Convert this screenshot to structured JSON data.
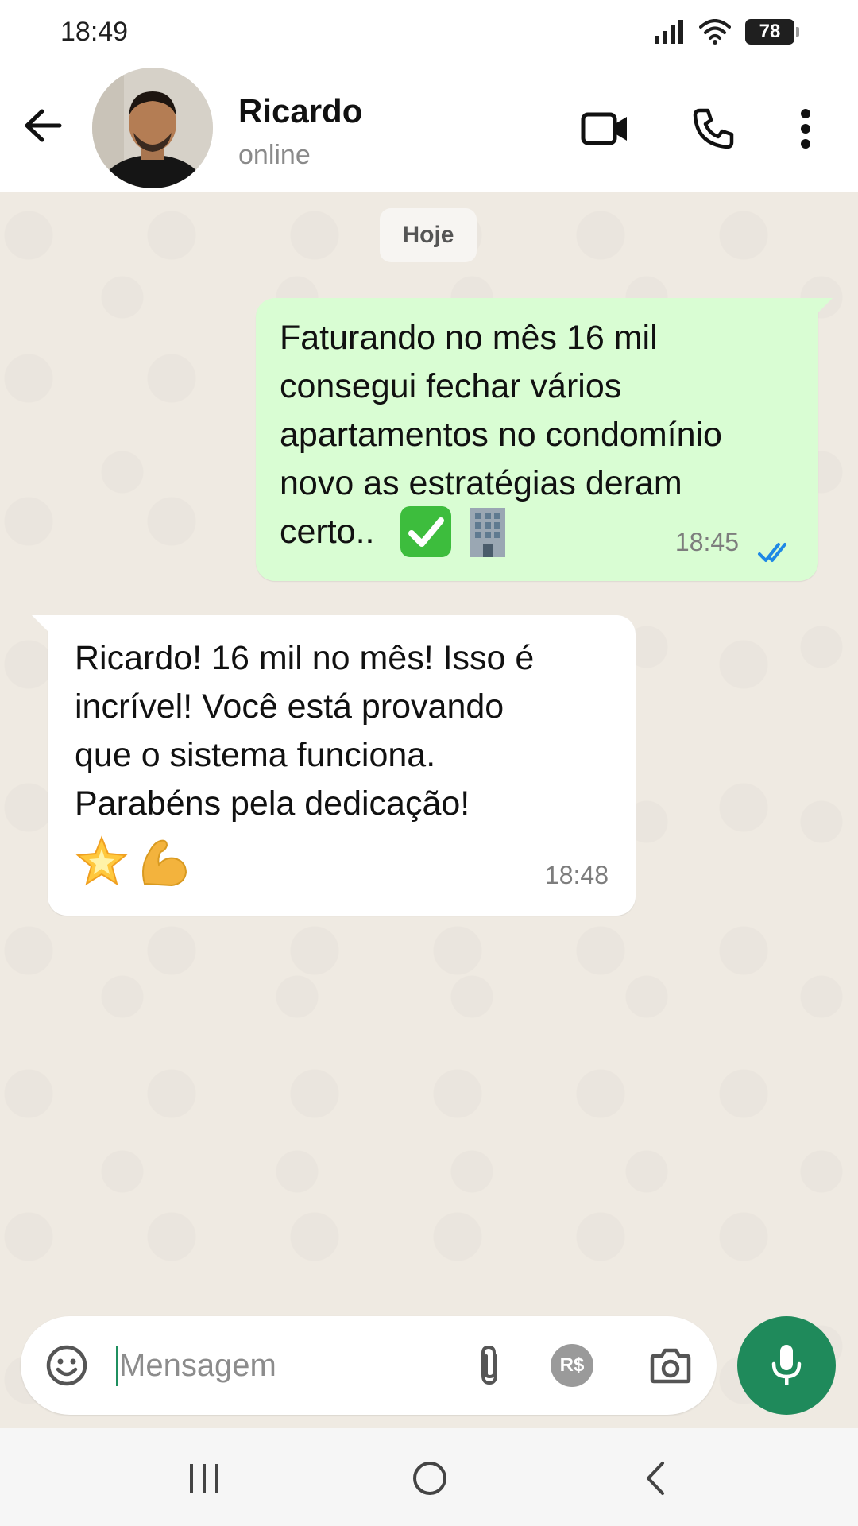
{
  "status_bar": {
    "time": "18:49",
    "battery": "78",
    "icons": [
      "signal-icon",
      "wifi-icon",
      "battery-icon"
    ]
  },
  "header": {
    "contact_name": "Ricardo",
    "contact_status": "online",
    "icons": [
      "back-arrow-icon",
      "video-call-icon",
      "phone-icon",
      "more-vert-icon"
    ]
  },
  "chat": {
    "date_chip": "Hoje",
    "messages": [
      {
        "direction": "outgoing",
        "text": "Faturando no mês 16 mil\nconsegui fechar vários\napartamentos no condomínio\nnovo as estratégias deram\ncerto..",
        "emojis": [
          "check-mark-emoji",
          "office-building-emoji"
        ],
        "time": "18:45",
        "read": true
      },
      {
        "direction": "incoming",
        "text": "Ricardo! 16 mil no mês! Isso é\nincrível! Você está provando\nque o sistema funciona.\nParabéns pela dedicação!",
        "emojis": [
          "glowing-star-emoji",
          "flexed-biceps-emoji"
        ],
        "time": "18:48"
      }
    ]
  },
  "input_bar": {
    "placeholder": "Mensagem",
    "value": "",
    "currency_label": "R$",
    "icons": [
      "emoji-icon",
      "attach-icon",
      "payment-icon",
      "camera-icon",
      "mic-icon"
    ]
  },
  "colors": {
    "outgoing_bubble": "#d9fdd3",
    "incoming_bubble": "#ffffff",
    "chat_background": "#efeae2",
    "accent": "#1f8a5b",
    "read_ticks": "#1e88e5"
  },
  "nav_bar": {
    "icons": [
      "recents-icon",
      "home-icon",
      "back-nav-icon"
    ]
  }
}
